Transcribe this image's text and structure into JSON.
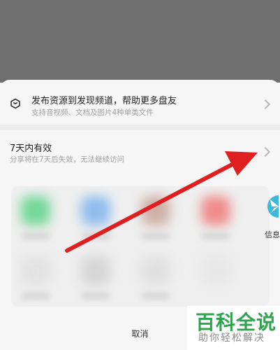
{
  "publish": {
    "title": "发布资源到发现频道，帮助更多盘友",
    "subtitle": "支持音视频、文档及图片4种单类文件",
    "icon": "cube-icon"
  },
  "validity": {
    "title": "7天内有效",
    "subtitle": "分享将在7天后失效，无法继续访问"
  },
  "share_targets": {
    "partial_label": "信息"
  },
  "cancel_label": "取消",
  "watermark": {
    "main": "百科全说",
    "sub": "助你轻松解决"
  },
  "colors": {
    "accent_arrow": "#e02020",
    "watermark_green": "#2fa44f"
  }
}
